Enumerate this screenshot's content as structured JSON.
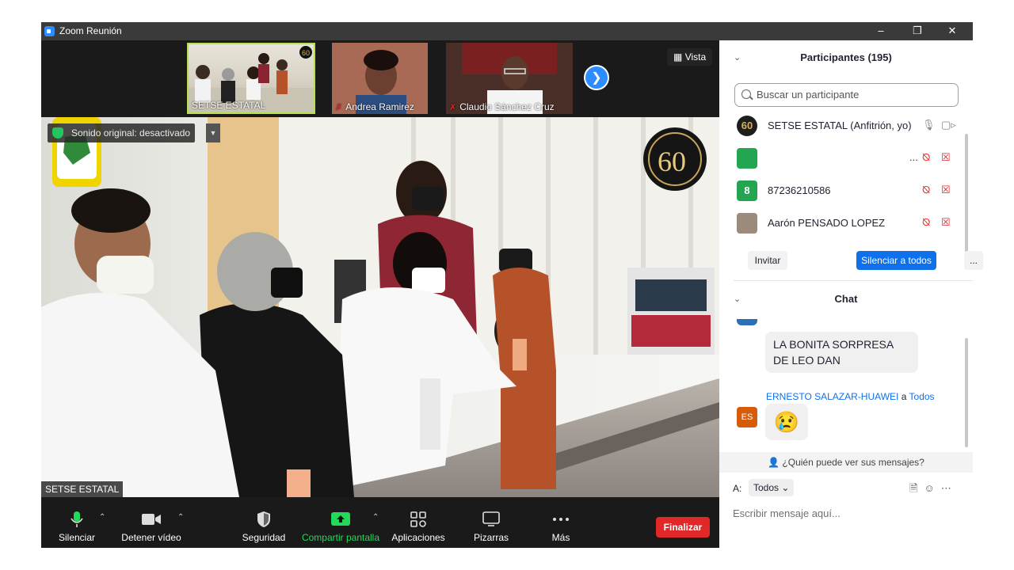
{
  "window": {
    "title": "Zoom Reunión"
  },
  "thumbnails": [
    {
      "name": "SETSE ESTATAL",
      "muted": false
    },
    {
      "name": "Andrea Ramirez",
      "muted": true
    },
    {
      "name": "Claudio Sánchez Cruz",
      "muted": true
    }
  ],
  "view": {
    "label": "Vista"
  },
  "main_video": {
    "original_sound": "Sonido original: desactivado",
    "speaker_name": "SETSE ESTATAL",
    "badge_text": "60"
  },
  "toolbar": {
    "mute": "Silenciar",
    "stop_video": "Detener vídeo",
    "security": "Seguridad",
    "share": "Compartir pantalla",
    "apps": "Aplicaciones",
    "whiteboards": "Pizarras",
    "more": "Más",
    "end": "Finalizar"
  },
  "participants": {
    "title": "Participantes (195)",
    "search_placeholder": "Buscar un participante",
    "list": [
      {
        "avatar": "60",
        "name": "SETSE ESTATAL (Anfitrión, yo)",
        "avatar_color": "#1e1e1e"
      },
      {
        "avatar": "",
        "name": "",
        "avatar_color": "#23a552"
      },
      {
        "avatar": "8",
        "name": "87236210586",
        "avatar_color": "#23a552"
      },
      {
        "avatar": "",
        "name": "Aarón PENSADO LOPEZ",
        "avatar_color": "#9c8b7a"
      }
    ],
    "invite": "Invitar",
    "mute_all": "Silenciar a todos",
    "more": "..."
  },
  "chat": {
    "title": "Chat",
    "prev_message": "LA BONITA SORPRESA DE LEO DAN",
    "sender": "ERNESTO SALAZAR-HUAWEI",
    "to_word": "a",
    "recipient": "Todos",
    "sender_initials": "ES",
    "emoji": "😢",
    "who_can_see": "¿Quién puede ver sus mensajes?",
    "to_label": "A:",
    "to_value": "Todos",
    "input_placeholder": "Escribir mensaje aquí..."
  },
  "colors": {
    "accent": "#0e71eb",
    "end": "#e02828",
    "share": "#23d959"
  }
}
